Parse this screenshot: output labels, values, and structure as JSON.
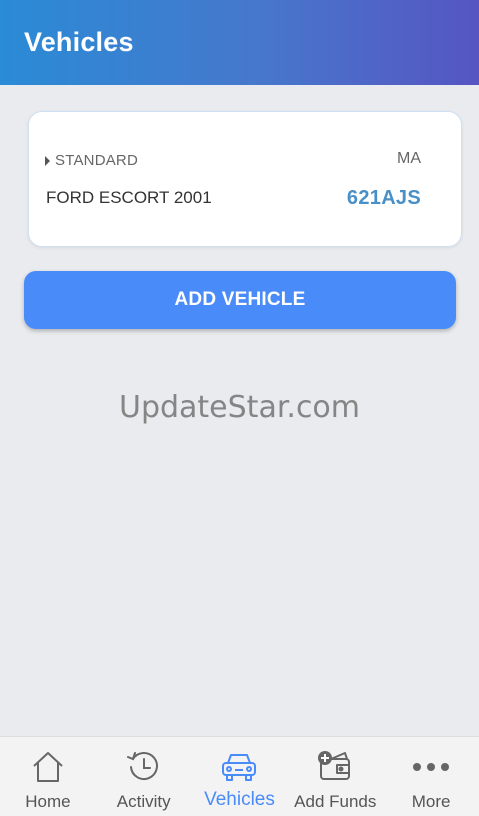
{
  "header": {
    "title": "Vehicles"
  },
  "vehicle": {
    "plan": "STANDARD",
    "state": "MA",
    "name": "FORD ESCORT 2001",
    "plate": "621AJS"
  },
  "add_vehicle_label": "ADD VEHICLE",
  "watermark": "UpdateStar.com",
  "nav": {
    "items": [
      {
        "label": "Home",
        "icon": "home-icon"
      },
      {
        "label": "Activity",
        "icon": "history-clock-icon"
      },
      {
        "label": "Vehicles",
        "icon": "car-icon",
        "active": true
      },
      {
        "label": "Add Funds",
        "icon": "wallet-add-icon"
      },
      {
        "label": "More",
        "icon": "more-dots-icon"
      }
    ]
  },
  "colors": {
    "header_gradient_start": "#2a8bd6",
    "header_gradient_end": "#5655c2",
    "accent": "#4a8bfa",
    "plate": "#4a90c8",
    "background": "#e9ebee"
  }
}
